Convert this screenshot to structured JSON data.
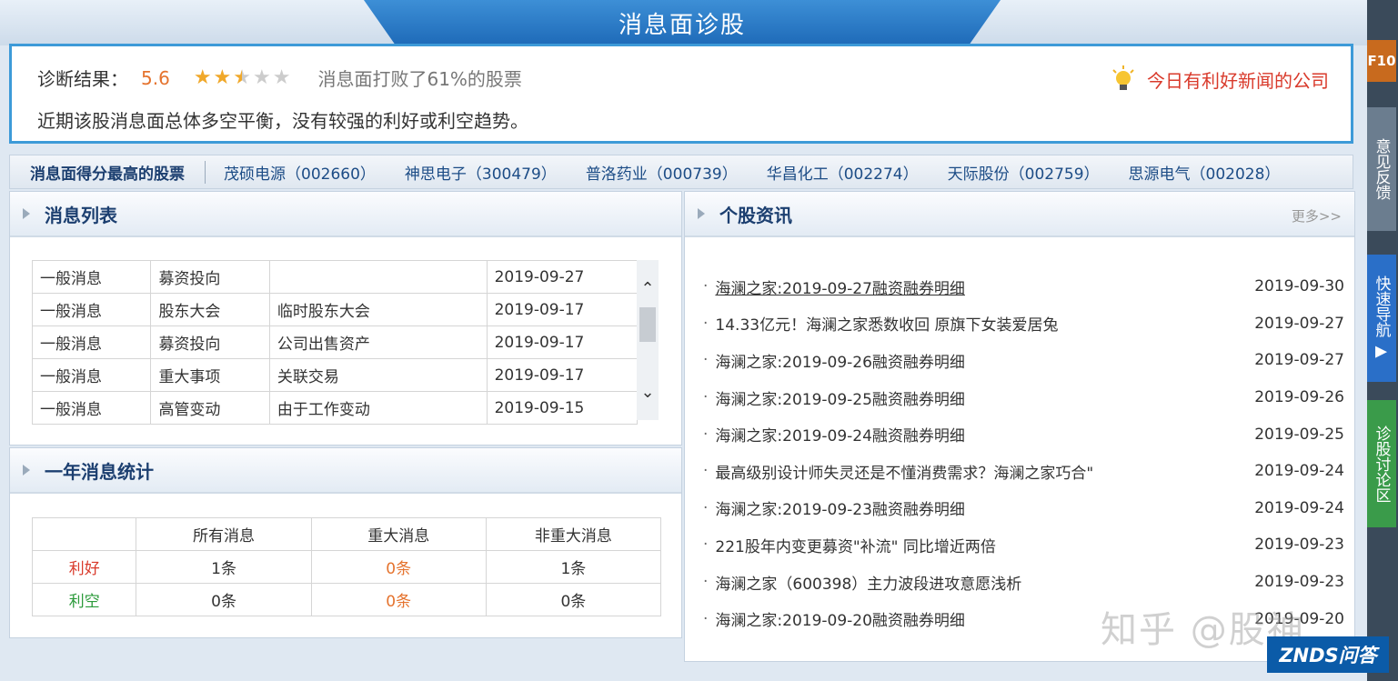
{
  "title": "消息面诊股",
  "diagnosis": {
    "label": "诊断结果：",
    "score": "5.6",
    "stars": 2.5,
    "star_max": 5,
    "beat_text": "消息面打败了61%的股票",
    "summary": "近期该股消息面总体多空平衡，没有较强的利好或利空趋势。",
    "news_link": "今日有利好新闻的公司"
  },
  "hot_stocks": {
    "title": "消息面得分最高的股票",
    "items": [
      "茂硕电源（002660）",
      "神思电子（300479）",
      "普洛药业（000739）",
      "华昌化工（002274）",
      "天际股份（002759）",
      "思源电气（002028）"
    ]
  },
  "message_list": {
    "title": "消息列表",
    "rows": [
      [
        "一般消息",
        "募资投向",
        "",
        "2019-09-27"
      ],
      [
        "一般消息",
        "股东大会",
        "临时股东大会",
        "2019-09-17"
      ],
      [
        "一般消息",
        "募资投向",
        "公司出售资产",
        "2019-09-17"
      ],
      [
        "一般消息",
        "重大事项",
        "关联交易",
        "2019-09-17"
      ],
      [
        "一般消息",
        "高管变动",
        "由于工作变动",
        "2019-09-15"
      ]
    ]
  },
  "year_stats": {
    "title": "一年消息统计",
    "headers": [
      "",
      "所有消息",
      "重大消息",
      "非重大消息"
    ],
    "rows": [
      [
        "利好",
        "1条",
        "0条",
        "1条"
      ],
      [
        "利空",
        "0条",
        "0条",
        "0条"
      ]
    ]
  },
  "stock_news": {
    "title": "个股资讯",
    "more": "更多>>",
    "items": [
      {
        "text": "海澜之家:2019-09-27融资融券明细",
        "date": "2019-09-30"
      },
      {
        "text": "14.33亿元！海澜之家悉数收回 原旗下女装爱居兔",
        "date": "2019-09-27"
      },
      {
        "text": "海澜之家:2019-09-26融资融券明细",
        "date": "2019-09-27"
      },
      {
        "text": "海澜之家:2019-09-25融资融券明细",
        "date": "2019-09-26"
      },
      {
        "text": "海澜之家:2019-09-24融资融券明细",
        "date": "2019-09-25"
      },
      {
        "text": "最高级别设计师失灵还是不懂消费需求？海澜之家巧合\"",
        "date": "2019-09-24"
      },
      {
        "text": "海澜之家:2019-09-23融资融券明细",
        "date": "2019-09-24"
      },
      {
        "text": "221股年内变更募资\"补流\" 同比增近两倍",
        "date": "2019-09-23"
      },
      {
        "text": "海澜之家（600398）主力波段进攻意愿浅析",
        "date": "2019-09-23"
      },
      {
        "text": "海澜之家:2019-09-20融资融券明细",
        "date": "2019-09-20"
      }
    ]
  },
  "side_tabs": {
    "f10": "F10",
    "feedback": "意见反馈",
    "quick_nav": "快速导航 ▶",
    "discussion": "诊股讨论区"
  },
  "watermark": "知乎 @股神",
  "badge": "ZNDS问答",
  "colors": {
    "accent_blue": "#3d9ad8",
    "bullish": "#d93a2b",
    "bearish": "#2b9a3a",
    "highlight_orange": "#e5732e"
  }
}
